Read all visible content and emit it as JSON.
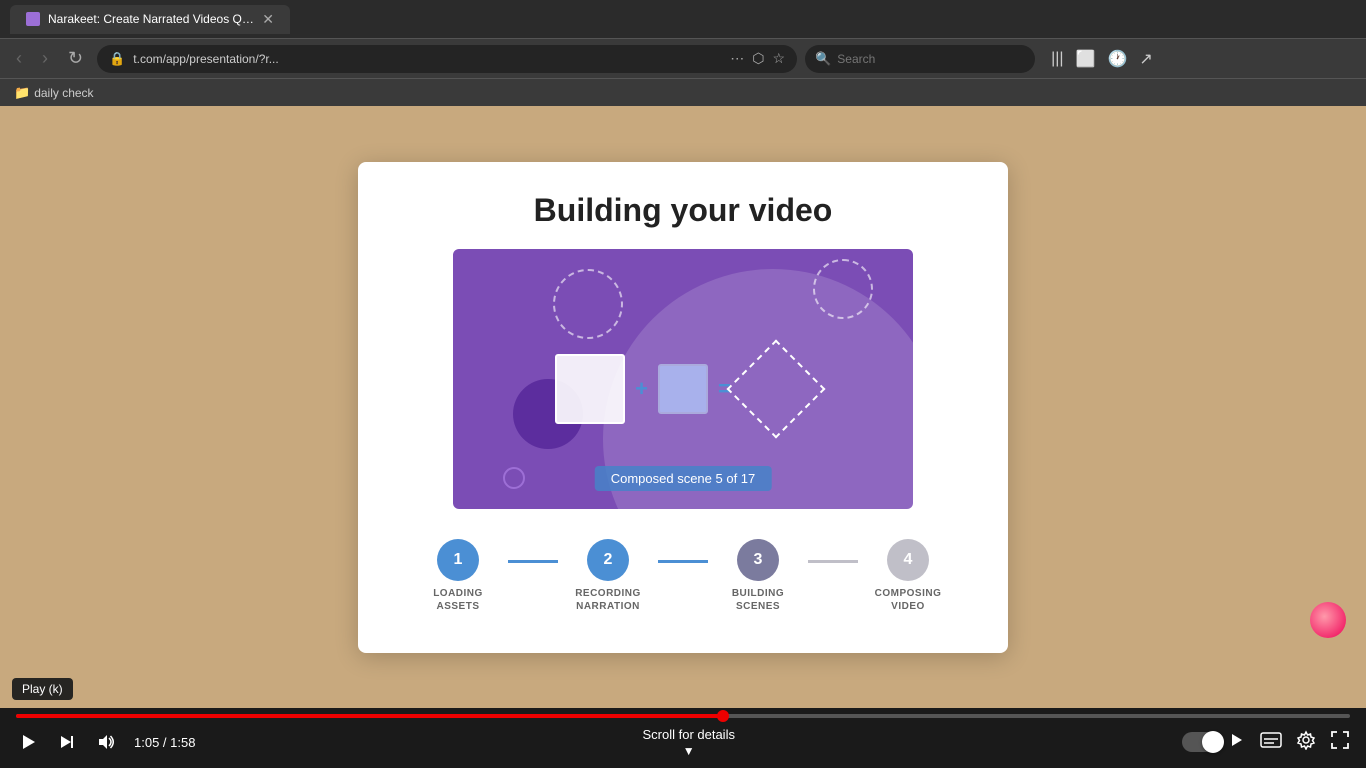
{
  "browser": {
    "tab_title": "Narakeet: Create Narrated Videos Quickly!",
    "address": "t.com/app/presentation/?r...",
    "search_placeholder": "Search",
    "bookmarks": [
      {
        "label": "daily check",
        "icon": "folder"
      }
    ]
  },
  "toolbar": {
    "more_icon": "⋯",
    "pocket_icon": "⬡",
    "star_icon": "☆",
    "history_icon": "🕐",
    "share_icon": "↗",
    "library_icon": "|||",
    "reader_icon": "⬜",
    "search_label": "Search"
  },
  "slide": {
    "title": "Building your video",
    "diagram_label": "Composed scene 5 of 17",
    "steps": [
      {
        "number": "1",
        "label": "LOADING\nASSETS",
        "state": "completed"
      },
      {
        "number": "2",
        "label": "RECORDING\nNARRATION",
        "state": "completed"
      },
      {
        "number": "3",
        "label": "BUILDING\nSCENES",
        "state": "current"
      },
      {
        "number": "4",
        "label": "COMPOSING\nVIDEO",
        "state": "inactive"
      }
    ]
  },
  "video_controls": {
    "current_time": "1:05",
    "total_time": "1:58",
    "time_display": "1:05 / 1:58",
    "scroll_label": "Scroll for details",
    "play_tooltip": "Play (k)"
  }
}
